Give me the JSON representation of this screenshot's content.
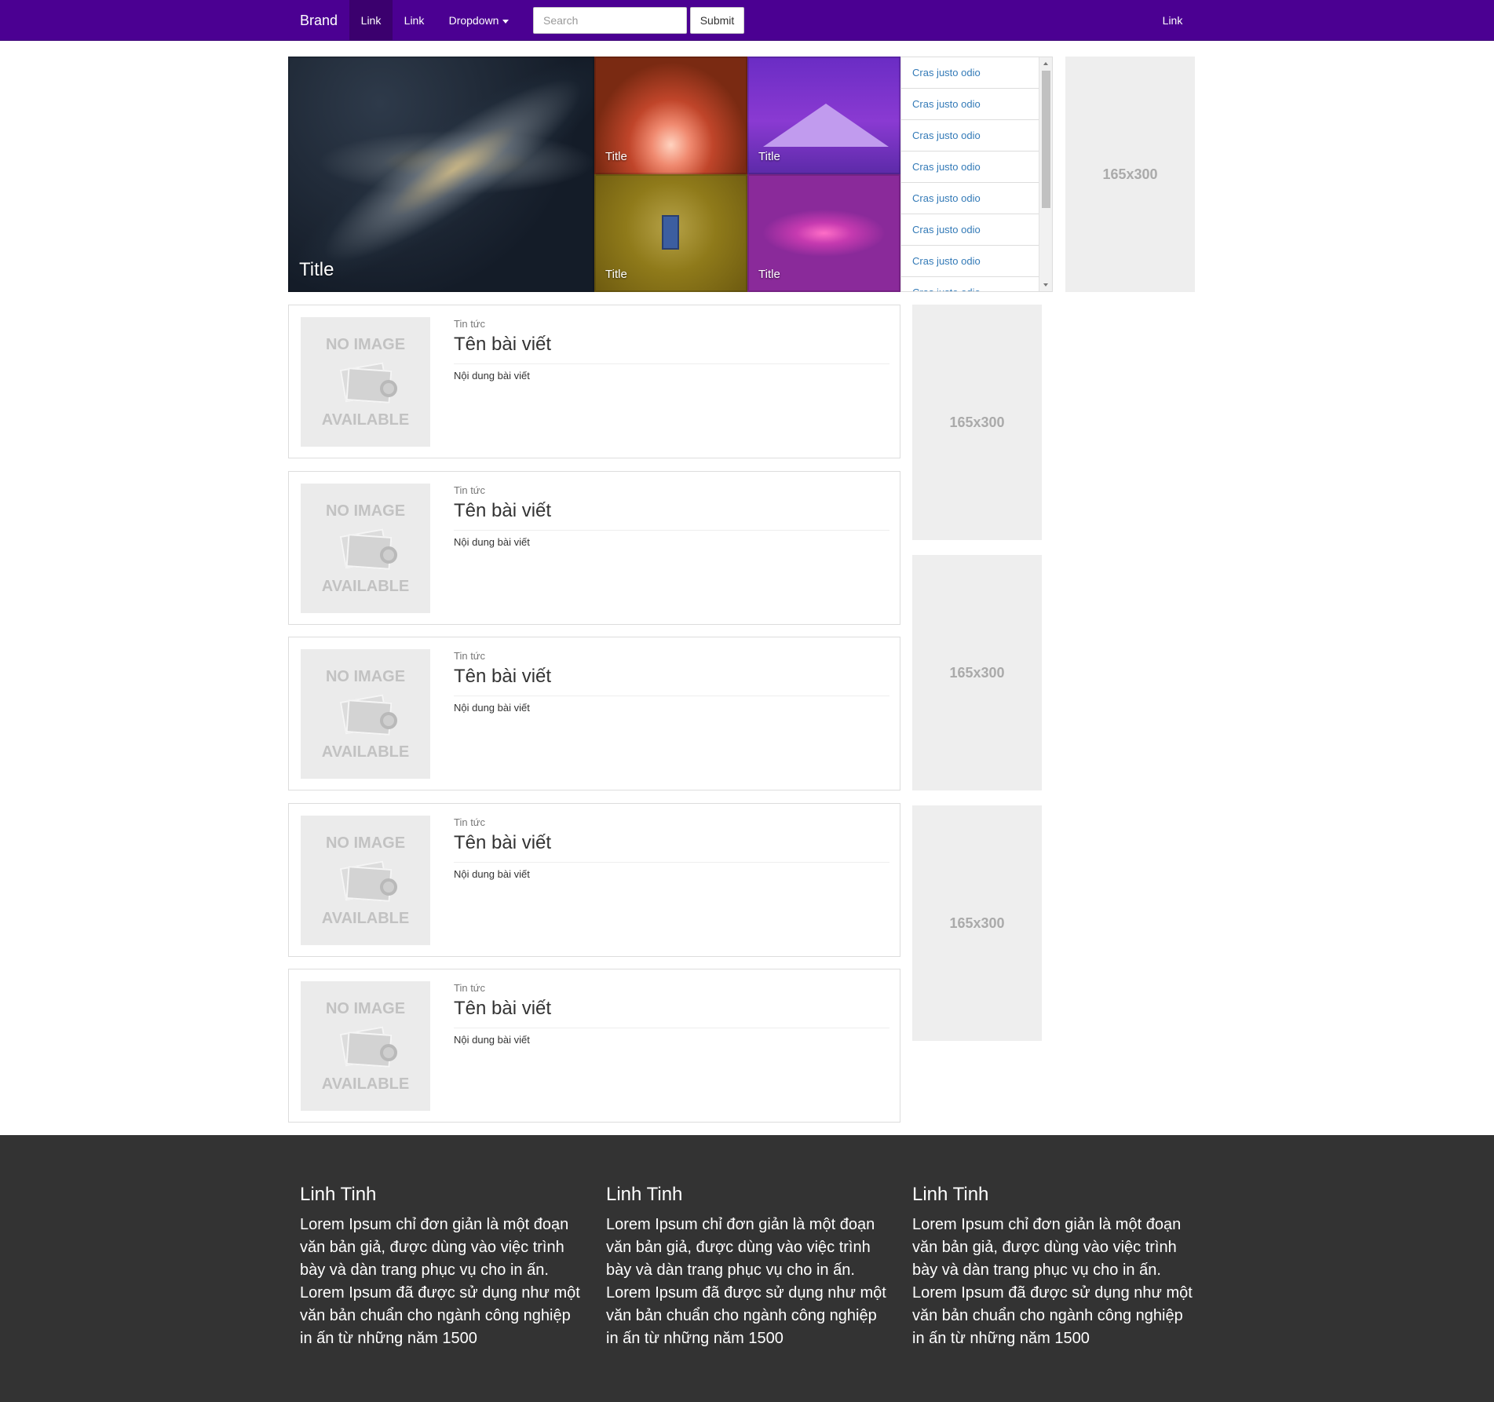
{
  "navbar": {
    "brand": "Brand",
    "links": [
      "Link",
      "Link"
    ],
    "dropdown": "Dropdown",
    "search_placeholder": "Search",
    "submit_label": "Submit",
    "right_link": "Link",
    "color": "#4b0092"
  },
  "tiles": {
    "big_title": "Title",
    "small_titles": [
      "Title",
      "Title",
      "Title",
      "Title"
    ]
  },
  "sidebar_list": {
    "items": [
      "Cras justo odio",
      "Cras justo odio",
      "Cras justo odio",
      "Cras justo odio",
      "Cras justo odio",
      "Cras justo odio",
      "Cras justo odio",
      "Cras justo odio"
    ]
  },
  "ads": {
    "label": "165x300"
  },
  "articles": [
    {
      "category": "Tin tức",
      "title": "Tên bài viết",
      "content": "Nội dung bài viết",
      "image_top": "NO IMAGE",
      "image_bottom": "AVAILABLE"
    },
    {
      "category": "Tin tức",
      "title": "Tên bài viết",
      "content": "Nội dung bài viết",
      "image_top": "NO IMAGE",
      "image_bottom": "AVAILABLE"
    },
    {
      "category": "Tin tức",
      "title": "Tên bài viết",
      "content": "Nội dung bài viết",
      "image_top": "NO IMAGE",
      "image_bottom": "AVAILABLE"
    },
    {
      "category": "Tin tức",
      "title": "Tên bài viết",
      "content": "Nội dung bài viết",
      "image_top": "NO IMAGE",
      "image_bottom": "AVAILABLE"
    },
    {
      "category": "Tin tức",
      "title": "Tên bài viết",
      "content": "Nội dung bài viết",
      "image_top": "NO IMAGE",
      "image_bottom": "AVAILABLE"
    }
  ],
  "footer": {
    "columns": [
      {
        "title": "Linh Tinh",
        "text": "Lorem Ipsum chỉ đơn giản là một đoạn văn bản giả, được dùng vào việc trình bày và dàn trang phục vụ cho in ấn. Lorem Ipsum đã được sử dụng như một văn bản chuẩn cho ngành công nghiệp in ấn từ những năm 1500"
      },
      {
        "title": "Linh Tinh",
        "text": "Lorem Ipsum chỉ đơn giản là một đoạn văn bản giả, được dùng vào việc trình bày và dàn trang phục vụ cho in ấn. Lorem Ipsum đã được sử dụng như một văn bản chuẩn cho ngành công nghiệp in ấn từ những năm 1500"
      },
      {
        "title": "Linh Tinh",
        "text": "Lorem Ipsum chỉ đơn giản là một đoạn văn bản giả, được dùng vào việc trình bày và dàn trang phục vụ cho in ấn. Lorem Ipsum đã được sử dụng như một văn bản chuẩn cho ngành công nghiệp in ấn từ những năm 1500"
      }
    ],
    "background": "#333333"
  }
}
